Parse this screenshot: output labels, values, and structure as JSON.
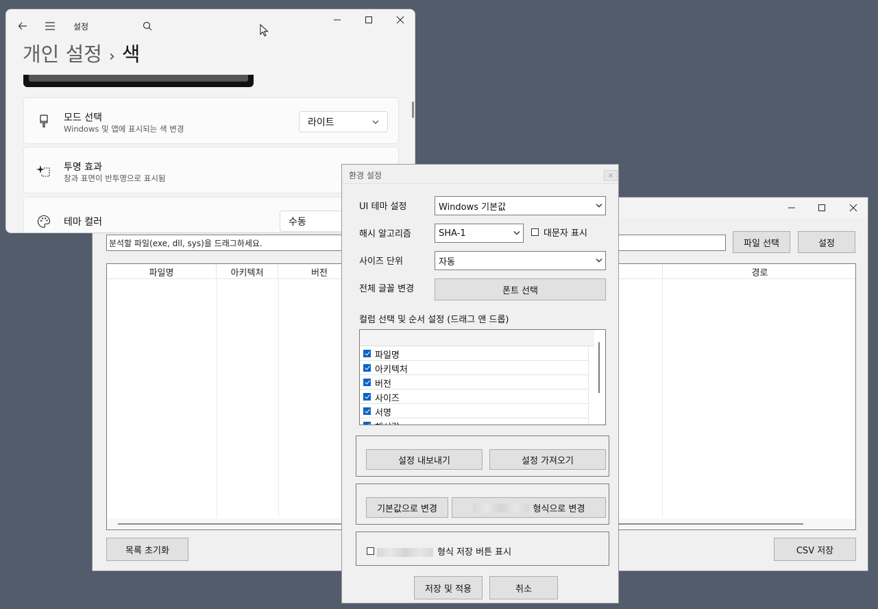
{
  "analyzer": {
    "drop_hint": "분석할 파일(exe, dll, sys)을 드래그하세요.",
    "file_select_label": "파일 선택",
    "settings_label": "설정",
    "columns": [
      "파일명",
      "아키텍처",
      "버전",
      "경로"
    ],
    "reset_label": "목록 초기화",
    "csv_label": "CSV 저장"
  },
  "settings_app": {
    "app_title": "설정",
    "breadcrumb_parent": "개인 설정",
    "breadcrumb_sep": "›",
    "breadcrumb_current": "색",
    "mode": {
      "title": "모드 선택",
      "subtitle": "Windows 및 앱에 표시되는 색 변경",
      "value": "라이트"
    },
    "transparency": {
      "title": "투명 효과",
      "subtitle": "창과 표면이 반투명으로 표시됨"
    },
    "accent": {
      "title": "테마 컬러",
      "value": "수동"
    }
  },
  "dialog": {
    "title": "환경 설정",
    "close": "×",
    "ui_theme_label": "UI 테마 설정",
    "ui_theme_value": "Windows 기본값",
    "hash_label": "해시 알고리즘",
    "hash_value": "SHA-1",
    "uppercase_label": "대문자 표시",
    "uppercase_checked": false,
    "size_unit_label": "사이즈 단위",
    "size_unit_value": "자동",
    "font_label": "전체 글꼴 변경",
    "font_button": "폰트 선택",
    "columns_label": "컬럼 선택 및 순서 설정 (드래그 앤 드롭)",
    "column_items": [
      {
        "label": "파일명",
        "checked": true
      },
      {
        "label": "아키텍처",
        "checked": true
      },
      {
        "label": "버전",
        "checked": true
      },
      {
        "label": "사이즈",
        "checked": true
      },
      {
        "label": "서명",
        "checked": true
      },
      {
        "label": "해시값",
        "checked": true
      }
    ],
    "export_label": "설정 내보내기",
    "import_label": "설정 가져오기",
    "default_label": "기본값으로 변경",
    "format_change_label": "형식으로 변경",
    "show_format_save_label": "형식 저장 버튼 표시",
    "save_apply_label": "저장 및 적용",
    "cancel_label": "취소"
  }
}
